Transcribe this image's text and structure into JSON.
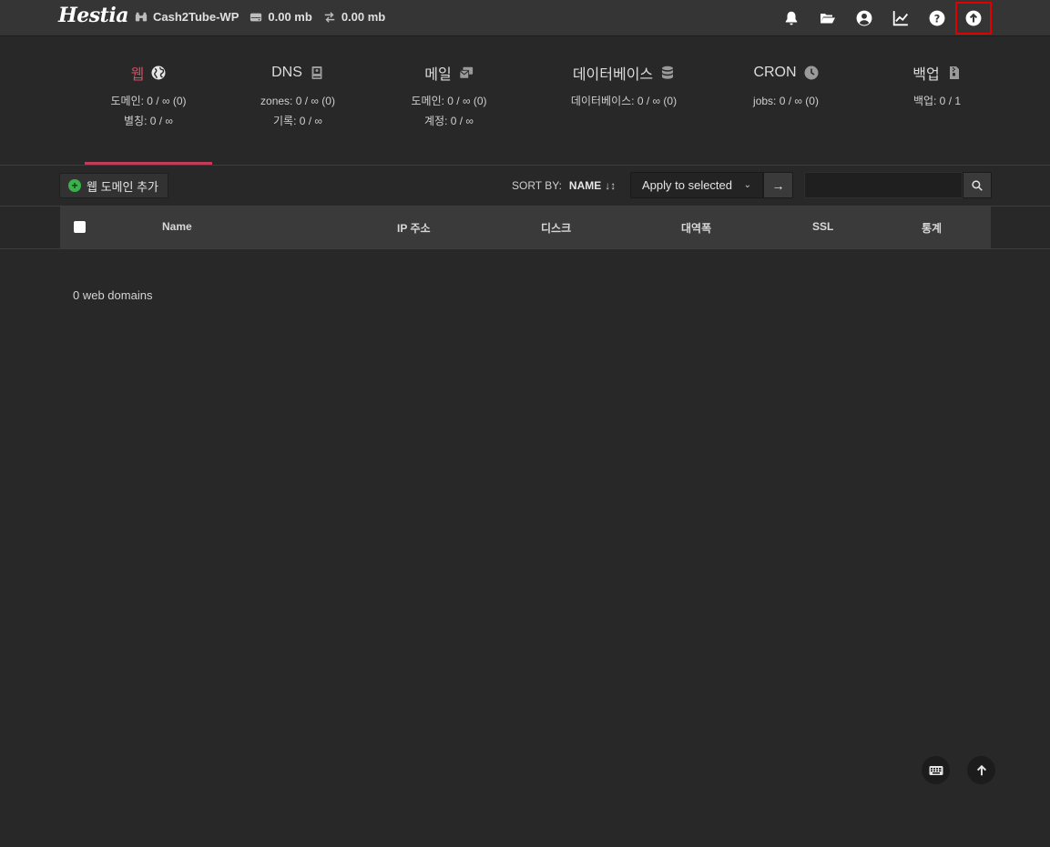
{
  "app": {
    "logo_text": "Hestia"
  },
  "topbar": {
    "user": "Cash2Tube-WP",
    "disk": "0.00 mb",
    "bandwidth": "0.00 mb",
    "icons": [
      "bell-icon",
      "folder-icon",
      "user-icon",
      "chart-icon",
      "help-icon",
      "update-icon"
    ]
  },
  "modules": [
    {
      "title": "웹",
      "icon": "globe-icon",
      "lines": [
        "도메인: 0 / ∞ (0)",
        "별칭: 0 / ∞"
      ],
      "active": true
    },
    {
      "title": "DNS",
      "icon": "book-icon",
      "lines": [
        "zones: 0 / ∞ (0)",
        "기록: 0 / ∞"
      ],
      "active": false
    },
    {
      "title": "메일",
      "icon": "mail-icon",
      "lines": [
        "도메인: 0 / ∞ (0)",
        "계정: 0 / ∞"
      ],
      "active": false
    },
    {
      "title": "데이터베이스",
      "icon": "database-icon",
      "lines": [
        "데이터베이스: 0 / ∞ (0)"
      ],
      "active": false
    },
    {
      "title": "CRON",
      "icon": "clock-icon",
      "lines": [
        "jobs: 0 / ∞ (0)"
      ],
      "active": false
    },
    {
      "title": "백업",
      "icon": "file-archive-icon",
      "lines": [
        "백업: 0 / 1"
      ],
      "active": false
    }
  ],
  "toolbar": {
    "add_label": "웹 도메인 추가",
    "sort_label": "SORT BY:",
    "sort_value": "NAME",
    "apply_label": "Apply to selected",
    "search_placeholder": ""
  },
  "table": {
    "columns": [
      "Name",
      "IP 주소",
      "디스크",
      "대역폭",
      "SSL",
      "통계"
    ]
  },
  "empty_text": "0 web domains",
  "colors": {
    "accent": "#c23c5a",
    "background": "#282828",
    "highlight": "#e00000",
    "add_icon": "#3bb04b"
  }
}
